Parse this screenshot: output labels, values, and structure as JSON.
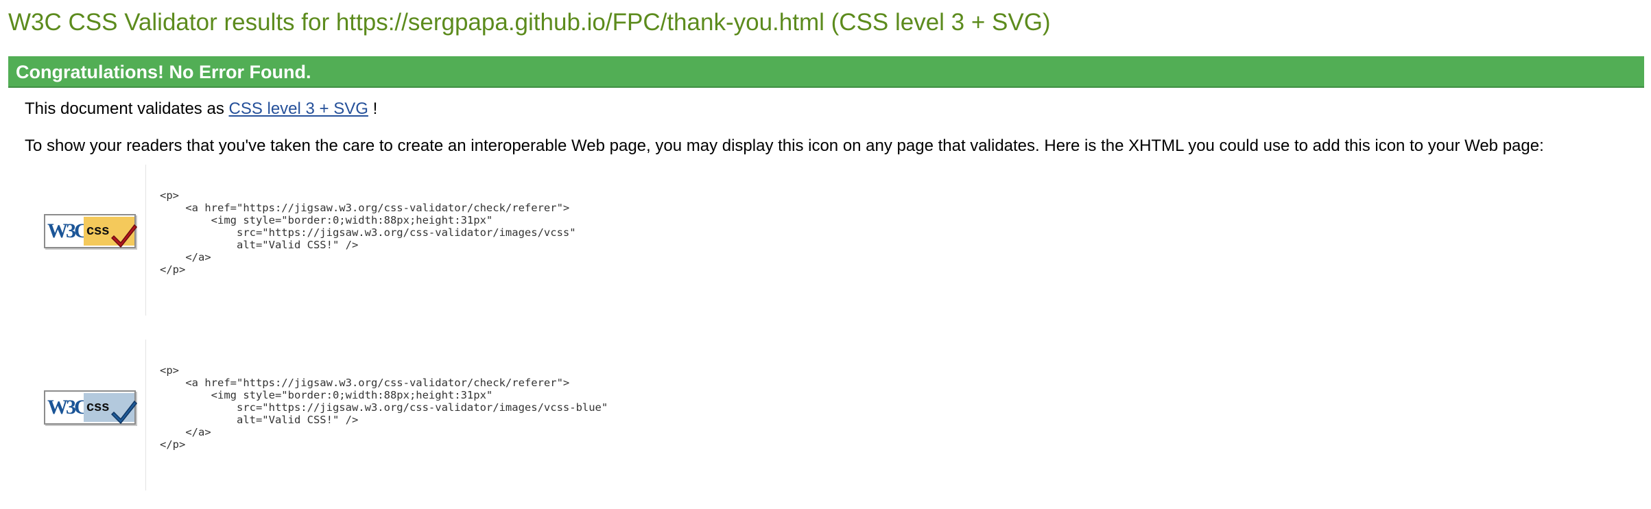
{
  "header": {
    "title": "W3C CSS Validator results for https://sergpapa.github.io/FPC/thank-you.html (CSS level 3 + SVG)"
  },
  "result": {
    "congrats": "Congratulations! No Error Found.",
    "validates_prefix": "This document validates as",
    "validates_link": "CSS level 3 + SVG",
    "validates_suffix": " !",
    "info": "To show your readers that you've taken the care to create an interoperable Web page, you may display this icon on any page that validates. Here is the XHTML you could use to add this icon to your Web page:"
  },
  "badges": [
    {
      "icon": "w3c-css-valid-gold-icon",
      "logo_text": "W3C",
      "css_text": "css",
      "code": "<p>\n    <a href=\"https://jigsaw.w3.org/css-validator/check/referer\">\n        <img style=\"border:0;width:88px;height:31px\"\n            src=\"https://jigsaw.w3.org/css-validator/images/vcss\"\n            alt=\"Valid CSS!\" />\n    </a>\n</p>"
    },
    {
      "icon": "w3c-css-valid-blue-icon",
      "logo_text": "W3C",
      "css_text": "css",
      "code": "<p>\n    <a href=\"https://jigsaw.w3.org/css-validator/check/referer\">\n        <img style=\"border:0;width:88px;height:31px\"\n            src=\"https://jigsaw.w3.org/css-validator/images/vcss-blue\"\n            alt=\"Valid CSS!\" />\n    </a>\n</p>"
    }
  ],
  "colors": {
    "title": "#5c8b1d",
    "congrats_bar": "#52ae55",
    "link": "#26519a",
    "badge_gold": "#f4c95b",
    "badge_blue": "#b3c9dd",
    "check_red": "#b2161e",
    "check_blue": "#1f5c99"
  }
}
